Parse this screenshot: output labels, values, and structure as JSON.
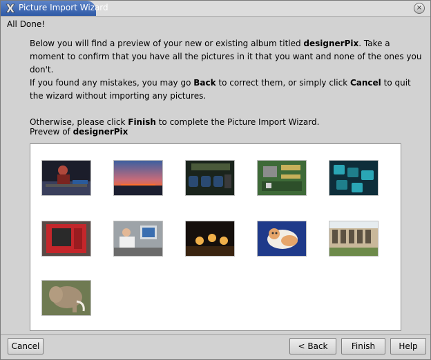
{
  "window": {
    "title": "Picture Import Wizard",
    "close_glyph": "×"
  },
  "page": {
    "header": "All Done!"
  },
  "instructions": {
    "line1_a": "Below you will find a preview of your new or existing album titled ",
    "album": "designerPix",
    "line1_b": ". Take a moment to confirm that you have all the pictures in it that you want and none of the ones you don't.",
    "line2_a": "If you found any mistakes, you may go ",
    "back_word": "Back",
    "line2_b": " to correct them, or simply click ",
    "cancel_word": "Cancel",
    "line2_c": " to quit the wizard without importing any pictures.",
    "line3_a": "Otherwise, please click ",
    "finish_word": "Finish",
    "line3_b": " to complete the Picture Import Wizard."
  },
  "preview": {
    "label_prefix": "Prevew of ",
    "album": "designerPix",
    "thumbnails": [
      {
        "subject": "dj-at-turntables"
      },
      {
        "subject": "sunset-over-sea"
      },
      {
        "subject": "circuit-board"
      },
      {
        "subject": "motherboard"
      },
      {
        "subject": "keyboard-keys"
      },
      {
        "subject": "red-computer-case"
      },
      {
        "subject": "person-at-desk"
      },
      {
        "subject": "concert-stage"
      },
      {
        "subject": "cat"
      },
      {
        "subject": "courtyard-building"
      },
      {
        "subject": "elephant"
      }
    ]
  },
  "buttons": {
    "cancel": "Cancel",
    "back": "< Back",
    "finish": "Finish",
    "help": "Help"
  },
  "colors": {
    "titlebar_accent": "#3b66b3",
    "window_bg": "#d2d2d2"
  }
}
